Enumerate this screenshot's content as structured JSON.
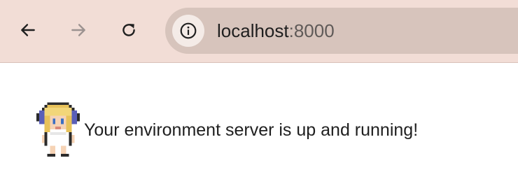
{
  "browser": {
    "url_host": "localhost",
    "url_port": ":8000",
    "back_icon": "arrow-left-icon",
    "forward_icon": "arrow-right-icon",
    "reload_icon": "reload-icon",
    "site_info_icon": "info-icon",
    "toolbar_color": "#f2ddd6",
    "omnibox_color": "#d7c4bc"
  },
  "page": {
    "avatar_icon": "pixel-character-icon",
    "message": "Your environment server is up and running!"
  }
}
